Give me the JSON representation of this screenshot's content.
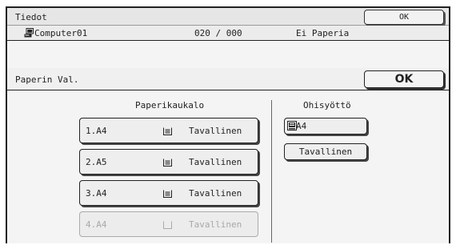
{
  "header": {
    "title": "Tiedot",
    "ok_label": "OK",
    "computer_name": "Computer01",
    "counter": "020 / 000",
    "paper_status": "Ei Paperia"
  },
  "dialog": {
    "title": "Paperin Val.",
    "ok_label": "OK"
  },
  "trays": {
    "heading": "Paperikaukalo",
    "items": [
      {
        "label": "1.A4",
        "type": "Tavallinen",
        "icon": "paper-stack-icon",
        "enabled": true
      },
      {
        "label": "2.A5",
        "type": "Tavallinen",
        "icon": "paper-stack-icon",
        "enabled": true
      },
      {
        "label": "3.A4",
        "type": "Tavallinen",
        "icon": "paper-stack-icon",
        "enabled": true
      },
      {
        "label": "4.A4",
        "type": "Tavallinen",
        "icon": "empty-tray-icon",
        "enabled": false
      }
    ]
  },
  "bypass": {
    "heading": "Ohisyöttö",
    "size_label": "A4",
    "type_label": "Tavallinen",
    "icon": "bypass-tray-icon"
  }
}
